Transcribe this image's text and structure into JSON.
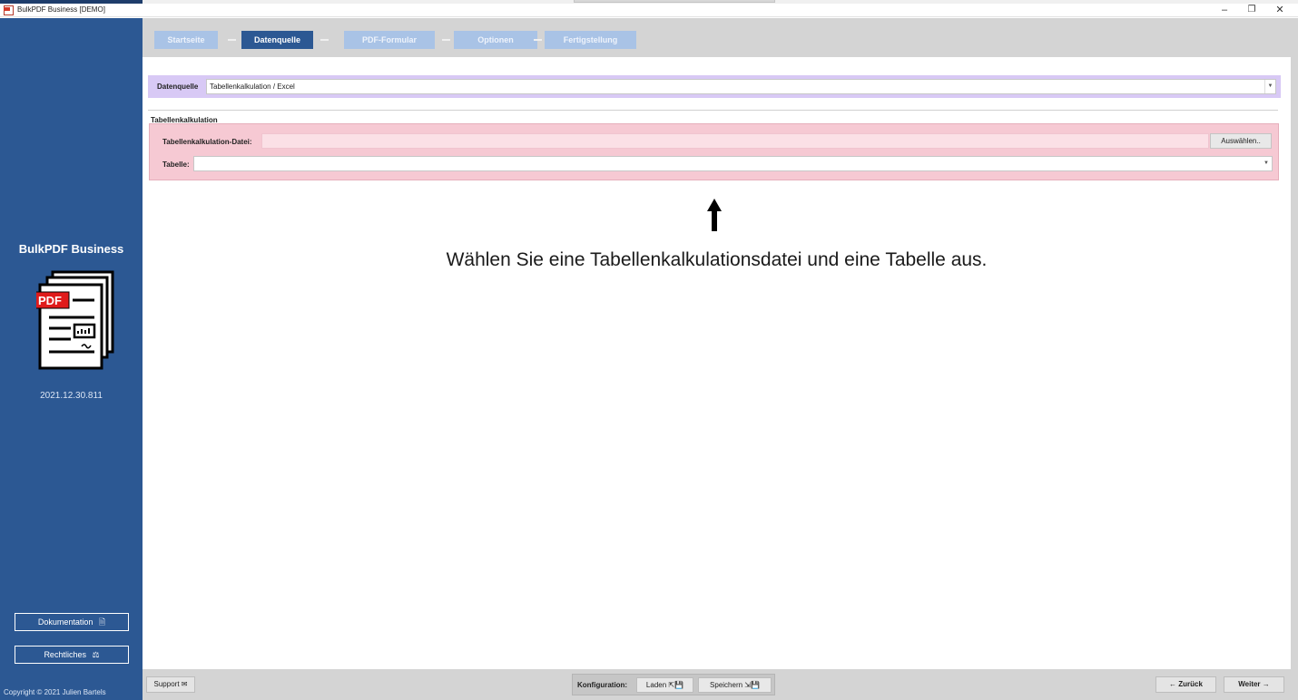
{
  "window": {
    "title": "BulkPDF Business [DEMO]",
    "minimize": "–",
    "maximize": "❐",
    "close": "✕"
  },
  "sidebar": {
    "brand": "BulkPDF Business",
    "logo_badge": "PDF",
    "version": "2021.12.30.811",
    "documentation_label": "Dokumentation",
    "documentation_icon": "document-icon",
    "legal_label": "Rechtliches",
    "legal_icon": "scales-icon",
    "copyright": "Copyright © 2021 Julien Bartels"
  },
  "steps": [
    {
      "label": "Startseite",
      "active": false
    },
    {
      "label": "Datenquelle",
      "active": true
    },
    {
      "label": "PDF-Formular",
      "active": false
    },
    {
      "label": "Optionen",
      "active": false
    },
    {
      "label": "Fertigstellung",
      "active": false
    }
  ],
  "datasource": {
    "label": "Datenquelle",
    "value": "Tabellenkalkulation / Excel"
  },
  "spreadsheet": {
    "group_title": "Tabellenkalkulation",
    "file_label": "Tabellenkalkulation-Datei:",
    "file_value": "",
    "pick_label": "Auswählen..",
    "table_label": "Tabelle:",
    "table_value": ""
  },
  "hint": {
    "text": "Wählen Sie eine Tabellenkalkulationsdatei und eine Tabelle aus."
  },
  "bottom": {
    "support_label": "Support ✉",
    "config_label": "Konfiguration:",
    "load_label": "Laden ⇱💾",
    "save_label": "Speichern ⇲💾",
    "back_label": "← Zurück",
    "next_label": "Weiter →"
  },
  "colors": {
    "sidebar": "#2c5893",
    "step_active": "#2c5893",
    "step_inactive": "#a9c3e6",
    "datasource_bg": "#d8c9f5",
    "group_bg": "#f6c9d3",
    "chrome": "#d4d4d4"
  }
}
